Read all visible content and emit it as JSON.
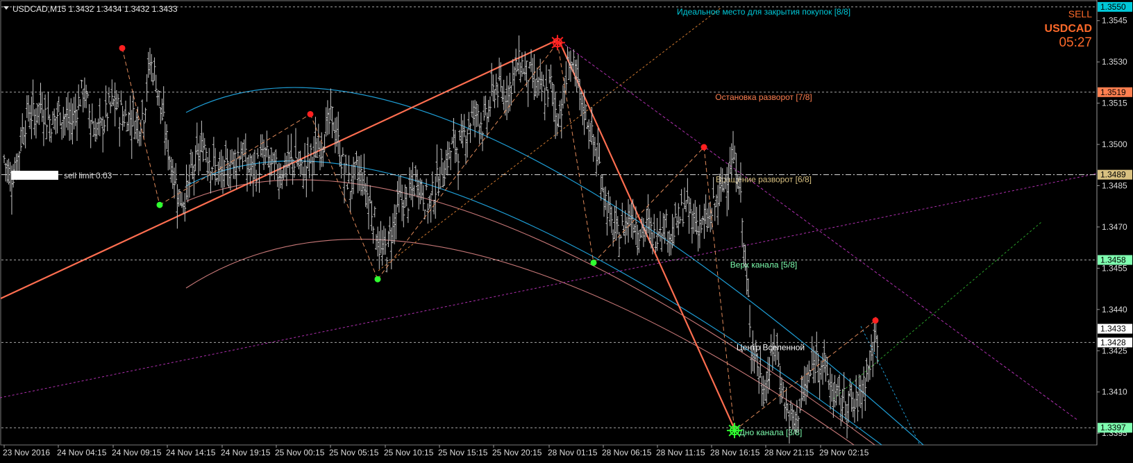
{
  "header": {
    "symbol_info": "USDCAD,M15  1.3432 1.3434 1.3432 1.3433"
  },
  "signal": {
    "direction": "SELL",
    "symbol": "USDCAD",
    "time": "05:27"
  },
  "order": {
    "label": "sell limit 0.03"
  },
  "colors": {
    "background": "#000000",
    "bars": "#c8c8c8",
    "cyan_text": "#00c8d8",
    "orange": "#ff7f50",
    "khaki": "#d8c080",
    "green": "#7fffb0",
    "white": "#ffffff",
    "sell_orange": "#ff6a2a"
  },
  "chart_data": {
    "type": "candlestick",
    "y_axis": {
      "range": [
        1.3391,
        1.3552
      ],
      "ticks": [
        "1.3545",
        "1.3530",
        "1.3515",
        "1.3500",
        "1.3485",
        "1.3470",
        "1.3455",
        "1.3440",
        "1.3425",
        "1.3410",
        "1.3395"
      ]
    },
    "x_axis": {
      "ticks": [
        "23 Nov 2016",
        "24 Nov 04:15",
        "24 Nov 09:15",
        "24 Nov 14:15",
        "24 Nov 19:15",
        "25 Nov 00:15",
        "25 Nov 05:15",
        "25 Nov 10:15",
        "25 Nov 15:15",
        "25 Nov 20:15",
        "28 Nov 01:15",
        "28 Nov 06:15",
        "28 Nov 11:15",
        "28 Nov 16:15",
        "28 Nov 21:15",
        "29 Nov 02:15"
      ]
    },
    "murrey_levels": [
      {
        "price": 1.355,
        "label": "1.3550",
        "text": "Идеальное место для закрытия покупок [8/8]",
        "color": "#00c8d8"
      },
      {
        "price": 1.3519,
        "label": "1.3519",
        "text": "Остановка разворот [7/8]",
        "color": "#ff7f50"
      },
      {
        "price": 1.3489,
        "label": "1.3489",
        "text": "Вращение разворот [6/8]",
        "color": "#d8c080"
      },
      {
        "price": 1.3458,
        "label": "1.3458",
        "text": "Верх канала [5/8]",
        "color": "#7fffb0"
      },
      {
        "price": 1.3428,
        "label": "1.3428",
        "text": "Центр Вселенной",
        "color": "#ffffff"
      },
      {
        "price": 1.3397,
        "label": "1.3397",
        "text": "Дно канала [3/8]",
        "color": "#7fffb0"
      }
    ],
    "current_price": {
      "price": 1.3433,
      "label": "1.3433"
    },
    "zigzag_points": [
      {
        "kind": "high",
        "price": 1.3535
      },
      {
        "kind": "low",
        "price": 1.3478
      },
      {
        "kind": "high",
        "price": 1.3511
      },
      {
        "kind": "low",
        "price": 1.3451
      },
      {
        "kind": "high",
        "price": 1.3537
      },
      {
        "kind": "low",
        "price": 1.3457
      },
      {
        "kind": "high",
        "price": 1.3499
      },
      {
        "kind": "low",
        "price": 1.3396
      },
      {
        "kind": "high",
        "price": 1.3436
      }
    ],
    "close_path": [
      1.3495,
      1.3488,
      1.3492,
      1.3505,
      1.3512,
      1.351,
      1.3515,
      1.351,
      1.3508,
      1.3512,
      1.351,
      1.3507,
      1.3514,
      1.352,
      1.3512,
      1.3505,
      1.3506,
      1.3512,
      1.3515,
      1.3512,
      1.351,
      1.351,
      1.3508,
      1.3512,
      1.353,
      1.3524,
      1.351,
      1.3498,
      1.3488,
      1.348,
      1.3482,
      1.349,
      1.3496,
      1.35,
      1.3494,
      1.349,
      1.3488,
      1.3492,
      1.3495,
      1.3498,
      1.3492,
      1.349,
      1.3493,
      1.3496,
      1.3492,
      1.349,
      1.3491,
      1.3493,
      1.3495,
      1.349,
      1.3493,
      1.3496,
      1.35,
      1.3505,
      1.351,
      1.35,
      1.349,
      1.3485,
      1.349,
      1.3488,
      1.348,
      1.3472,
      1.346,
      1.3462,
      1.347,
      1.348,
      1.3478,
      1.3482,
      1.3488,
      1.3482,
      1.3478,
      1.3485,
      1.349,
      1.3495,
      1.35,
      1.3498,
      1.3505,
      1.351,
      1.3512,
      1.3506,
      1.3515,
      1.3522,
      1.3518,
      1.352,
      1.3526,
      1.353,
      1.3526,
      1.3524,
      1.352,
      1.3518,
      1.3522,
      1.351,
      1.3515,
      1.3532,
      1.3525,
      1.3515,
      1.351,
      1.35,
      1.3492,
      1.348,
      1.347,
      1.3466,
      1.347,
      1.3475,
      1.3472,
      1.3468,
      1.347,
      1.3466,
      1.3472,
      1.347,
      1.3468,
      1.3472,
      1.3478,
      1.3474,
      1.3472,
      1.347,
      1.3472,
      1.3478,
      1.3482,
      1.349,
      1.3494,
      1.3488,
      1.3455,
      1.343,
      1.342,
      1.341,
      1.3418,
      1.3428,
      1.3412,
      1.3402,
      1.3398,
      1.3406,
      1.3412,
      1.3418,
      1.3424,
      1.342,
      1.3412,
      1.3408,
      1.3406,
      1.3408,
      1.3404,
      1.341,
      1.3418,
      1.3424,
      1.3433
    ]
  }
}
